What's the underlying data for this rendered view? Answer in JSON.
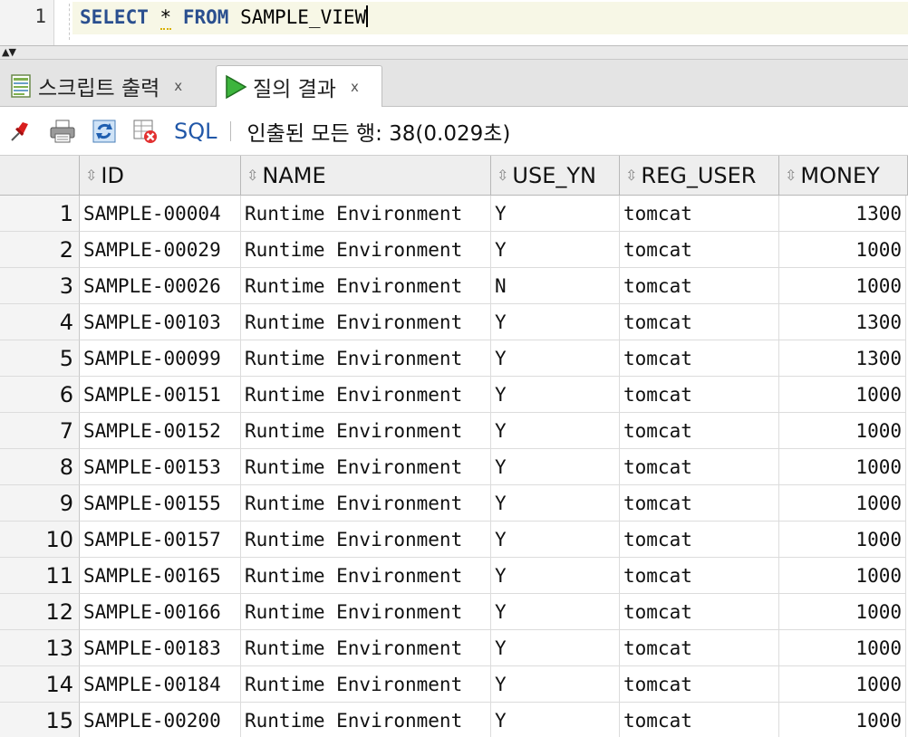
{
  "editor": {
    "line_number": "1",
    "kw_select": "SELECT",
    "star": "*",
    "kw_from": "FROM",
    "view_name": "SAMPLE_VIEW"
  },
  "tabs": {
    "script_output": "스크립트 출력",
    "query_result": "질의 결과",
    "close": "x"
  },
  "toolbar": {
    "sql_label": "SQL",
    "status": "인출된 모든 행: 38(0.029초)"
  },
  "grid": {
    "columns": [
      "ID",
      "NAME",
      "USE_YN",
      "REG_USER",
      "MONEY"
    ],
    "rows": [
      {
        "n": "1",
        "id": "SAMPLE-00004",
        "name": "Runtime Environment",
        "use": "Y",
        "reg": "tomcat",
        "money": "1300"
      },
      {
        "n": "2",
        "id": "SAMPLE-00029",
        "name": "Runtime Environment",
        "use": "Y",
        "reg": "tomcat",
        "money": "1000"
      },
      {
        "n": "3",
        "id": "SAMPLE-00026",
        "name": "Runtime Environment",
        "use": "N",
        "reg": "tomcat",
        "money": "1000"
      },
      {
        "n": "4",
        "id": "SAMPLE-00103",
        "name": "Runtime Environment",
        "use": "Y",
        "reg": "tomcat",
        "money": "1300"
      },
      {
        "n": "5",
        "id": "SAMPLE-00099",
        "name": "Runtime Environment",
        "use": "Y",
        "reg": "tomcat",
        "money": "1300"
      },
      {
        "n": "6",
        "id": "SAMPLE-00151",
        "name": "Runtime Environment",
        "use": "Y",
        "reg": "tomcat",
        "money": "1000"
      },
      {
        "n": "7",
        "id": "SAMPLE-00152",
        "name": "Runtime Environment",
        "use": "Y",
        "reg": "tomcat",
        "money": "1000"
      },
      {
        "n": "8",
        "id": "SAMPLE-00153",
        "name": "Runtime Environment",
        "use": "Y",
        "reg": "tomcat",
        "money": "1000"
      },
      {
        "n": "9",
        "id": "SAMPLE-00155",
        "name": "Runtime Environment",
        "use": "Y",
        "reg": "tomcat",
        "money": "1000"
      },
      {
        "n": "10",
        "id": "SAMPLE-00157",
        "name": "Runtime Environment",
        "use": "Y",
        "reg": "tomcat",
        "money": "1000"
      },
      {
        "n": "11",
        "id": "SAMPLE-00165",
        "name": "Runtime Environment",
        "use": "Y",
        "reg": "tomcat",
        "money": "1000"
      },
      {
        "n": "12",
        "id": "SAMPLE-00166",
        "name": "Runtime Environment",
        "use": "Y",
        "reg": "tomcat",
        "money": "1000"
      },
      {
        "n": "13",
        "id": "SAMPLE-00183",
        "name": "Runtime Environment",
        "use": "Y",
        "reg": "tomcat",
        "money": "1000"
      },
      {
        "n": "14",
        "id": "SAMPLE-00184",
        "name": "Runtime Environment",
        "use": "Y",
        "reg": "tomcat",
        "money": "1000"
      },
      {
        "n": "15",
        "id": "SAMPLE-00200",
        "name": "Runtime Environment",
        "use": "Y",
        "reg": "tomcat",
        "money": "1000"
      }
    ]
  },
  "colors": {
    "keyword": "#2a4f8f",
    "sql_button": "#2157a8",
    "run_icon": "#2e9a2e",
    "pin_icon": "#d81e1e"
  },
  "icons": [
    "script-output-icon",
    "run-result-icon",
    "pin-icon",
    "print-icon",
    "refresh-icon",
    "delete-grid-icon",
    "sort-icon"
  ]
}
